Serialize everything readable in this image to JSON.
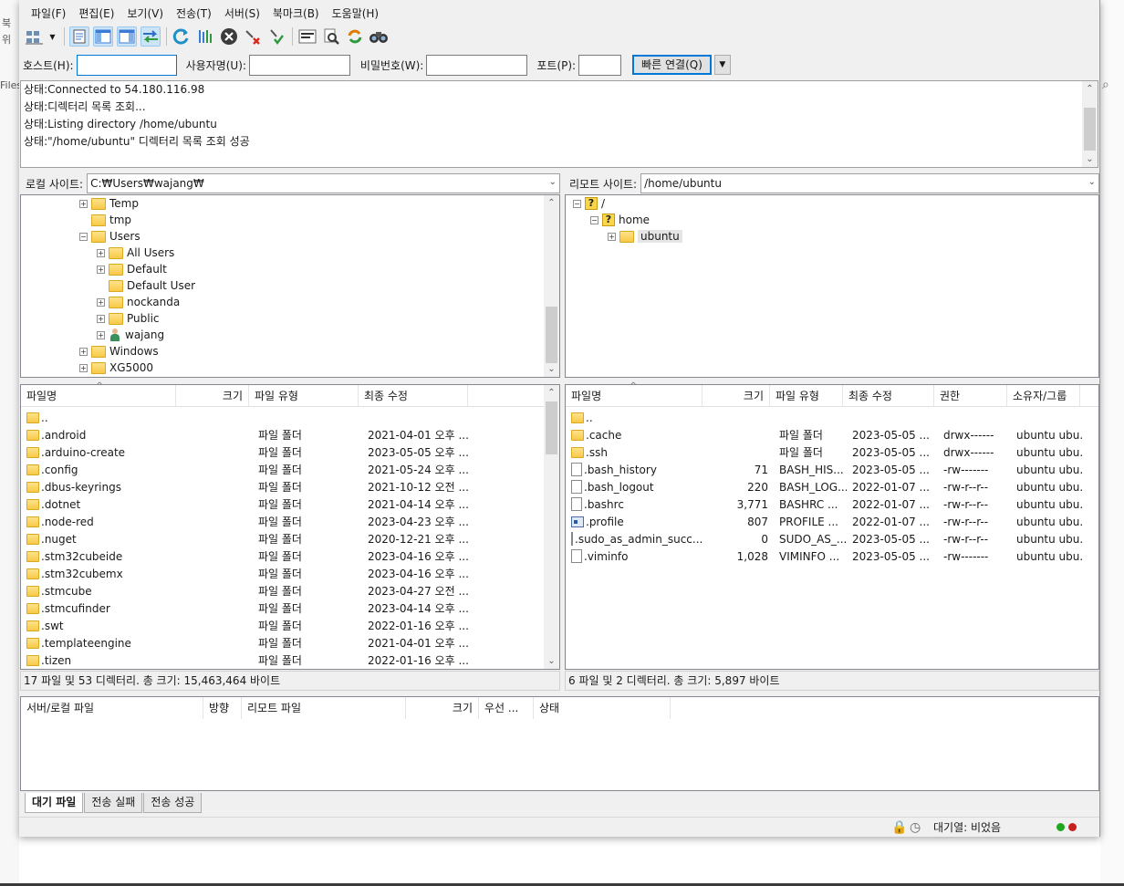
{
  "background": {
    "left_labels": [
      "북",
      "위",
      "Files"
    ]
  },
  "menu": [
    "파일(F)",
    "편집(E)",
    "보기(V)",
    "전송(T)",
    "서버(S)",
    "북마크(B)",
    "도움말(H)"
  ],
  "toolbar": {
    "icons": [
      "site-manager-icon",
      "toggle-message-log-icon",
      "toggle-local-tree-icon",
      "toggle-remote-tree-icon",
      "toggle-transfer-queue-icon",
      "refresh-icon",
      "process-queue-icon",
      "cancel-icon",
      "disconnect-icon",
      "reconnect-icon",
      "directory-filter-icon",
      "search-remote-files-icon",
      "sync-browsing-icon",
      "compare-directories-icon"
    ]
  },
  "quickconnect": {
    "host_label": "호스트(H):",
    "host_value": "",
    "user_label": "사용자명(U):",
    "user_value": "",
    "pass_label": "비밀번호(W):",
    "pass_value": "",
    "port_label": "포트(P):",
    "port_value": "",
    "button": "빠른 연결(Q)"
  },
  "log": [
    {
      "label": "상태:",
      "text": "Connected to 54.180.116.98"
    },
    {
      "label": "상태:",
      "text": "디렉터리 목록 조회..."
    },
    {
      "label": "상태:",
      "text": "Listing directory /home/ubuntu"
    },
    {
      "label": "상태:",
      "text": "\"/home/ubuntu\" 디렉터리 목록 조회 성공"
    }
  ],
  "local": {
    "site_label": "로컬 사이트:",
    "path": "C:₩Users₩wajang₩",
    "tree": [
      {
        "name": "Temp",
        "level": 0,
        "expander": "+"
      },
      {
        "name": "tmp",
        "level": 0,
        "expander": ""
      },
      {
        "name": "Users",
        "level": 0,
        "expander": "-"
      },
      {
        "name": "All Users",
        "level": 1,
        "expander": "+"
      },
      {
        "name": "Default",
        "level": 1,
        "expander": "+"
      },
      {
        "name": "Default User",
        "level": 1,
        "expander": ""
      },
      {
        "name": "nockanda",
        "level": 1,
        "expander": "+"
      },
      {
        "name": "Public",
        "level": 1,
        "expander": "+"
      },
      {
        "name": "wajang",
        "level": 1,
        "expander": "+",
        "user": true
      },
      {
        "name": "Windows",
        "level": 0,
        "expander": "+"
      },
      {
        "name": "XG5000",
        "level": 0,
        "expander": "+"
      }
    ],
    "columns": [
      "파일명",
      "크기",
      "파일 유형",
      "최종 수정"
    ],
    "files": [
      {
        "name": "..",
        "size": "",
        "type": "",
        "modified": ""
      },
      {
        "name": ".android",
        "size": "",
        "type": "파일 폴더",
        "modified": "2021-04-01 오후 ..."
      },
      {
        "name": ".arduino-create",
        "size": "",
        "type": "파일 폴더",
        "modified": "2023-05-05 오후 ..."
      },
      {
        "name": ".config",
        "size": "",
        "type": "파일 폴더",
        "modified": "2021-05-24 오후 ..."
      },
      {
        "name": ".dbus-keyrings",
        "size": "",
        "type": "파일 폴더",
        "modified": "2021-10-12 오전 ..."
      },
      {
        "name": ".dotnet",
        "size": "",
        "type": "파일 폴더",
        "modified": "2021-04-14 오후 ..."
      },
      {
        "name": ".node-red",
        "size": "",
        "type": "파일 폴더",
        "modified": "2023-04-23 오후 ..."
      },
      {
        "name": ".nuget",
        "size": "",
        "type": "파일 폴더",
        "modified": "2020-12-21 오후 ..."
      },
      {
        "name": ".stm32cubeide",
        "size": "",
        "type": "파일 폴더",
        "modified": "2023-04-16 오후 ..."
      },
      {
        "name": ".stm32cubemx",
        "size": "",
        "type": "파일 폴더",
        "modified": "2023-04-16 오후 ..."
      },
      {
        "name": ".stmcube",
        "size": "",
        "type": "파일 폴더",
        "modified": "2023-04-27 오전 ..."
      },
      {
        "name": ".stmcufinder",
        "size": "",
        "type": "파일 폴더",
        "modified": "2023-04-14 오후 ..."
      },
      {
        "name": ".swt",
        "size": "",
        "type": "파일 폴더",
        "modified": "2022-01-16 오후 ..."
      },
      {
        "name": ".templateengine",
        "size": "",
        "type": "파일 폴더",
        "modified": "2021-04-01 오후 ..."
      },
      {
        "name": ".tizen",
        "size": "",
        "type": "파일 폴더",
        "modified": "2022-01-16 오후 ..."
      }
    ],
    "status": "17 파일 및 53 디렉터리. 총 크기: 15,463,464 바이트"
  },
  "remote": {
    "site_label": "리모트 사이트:",
    "path": "/home/ubuntu",
    "tree": [
      {
        "name": "/",
        "level": 0,
        "expander": "-",
        "icon": "question"
      },
      {
        "name": "home",
        "level": 1,
        "expander": "-",
        "icon": "question"
      },
      {
        "name": "ubuntu",
        "level": 2,
        "expander": "+",
        "icon": "folder",
        "selected": true
      }
    ],
    "columns": [
      "파일명",
      "크기",
      "파일 유형",
      "최종 수정",
      "권한",
      "소유자/그룹"
    ],
    "files": [
      {
        "name": "..",
        "size": "",
        "type": "",
        "modified": "",
        "perms": "",
        "owner": "",
        "kind": "folder"
      },
      {
        "name": ".cache",
        "size": "",
        "type": "파일 폴더",
        "modified": "2023-05-05 ...",
        "perms": "drwx------",
        "owner": "ubuntu ubu...",
        "kind": "folder"
      },
      {
        "name": ".ssh",
        "size": "",
        "type": "파일 폴더",
        "modified": "2023-05-05 ...",
        "perms": "drwx------",
        "owner": "ubuntu ubu...",
        "kind": "folder"
      },
      {
        "name": ".bash_history",
        "size": "71",
        "type": "BASH_HIS...",
        "modified": "2023-05-05 ...",
        "perms": "-rw-------",
        "owner": "ubuntu ubu...",
        "kind": "file"
      },
      {
        "name": ".bash_logout",
        "size": "220",
        "type": "BASH_LOG...",
        "modified": "2022-01-07 ...",
        "perms": "-rw-r--r--",
        "owner": "ubuntu ubu...",
        "kind": "file"
      },
      {
        "name": ".bashrc",
        "size": "3,771",
        "type": "BASHRC ...",
        "modified": "2022-01-07 ...",
        "perms": "-rw-r--r--",
        "owner": "ubuntu ubu...",
        "kind": "file"
      },
      {
        "name": ".profile",
        "size": "807",
        "type": "PROFILE ...",
        "modified": "2022-01-07 ...",
        "perms": "-rw-r--r--",
        "owner": "ubuntu ubu...",
        "kind": "profile"
      },
      {
        "name": ".sudo_as_admin_succ...",
        "size": "0",
        "type": "SUDO_AS_...",
        "modified": "2023-05-05 ...",
        "perms": "-rw-r--r--",
        "owner": "ubuntu ubu...",
        "kind": "file"
      },
      {
        "name": ".viminfo",
        "size": "1,028",
        "type": "VIMINFO ...",
        "modified": "2023-05-05 ...",
        "perms": "-rw-------",
        "owner": "ubuntu ubu...",
        "kind": "file"
      }
    ],
    "status": "6 파일 및 2 디렉터리. 총 크기: 5,897 바이트"
  },
  "queue": {
    "columns": [
      "서버/로컬 파일",
      "방향",
      "리모트 파일",
      "크기",
      "우선 ...",
      "상태"
    ],
    "tabs": [
      "대기 파일",
      "전송 실패",
      "전송 성공"
    ],
    "active_tab": 0
  },
  "bottom_status": {
    "queue_text": "대기열: 비었음"
  },
  "colors": {
    "accent": "#0078d7",
    "folder": "#f7c948",
    "led_green": "#1fa81f",
    "led_red": "#c81f1f"
  }
}
